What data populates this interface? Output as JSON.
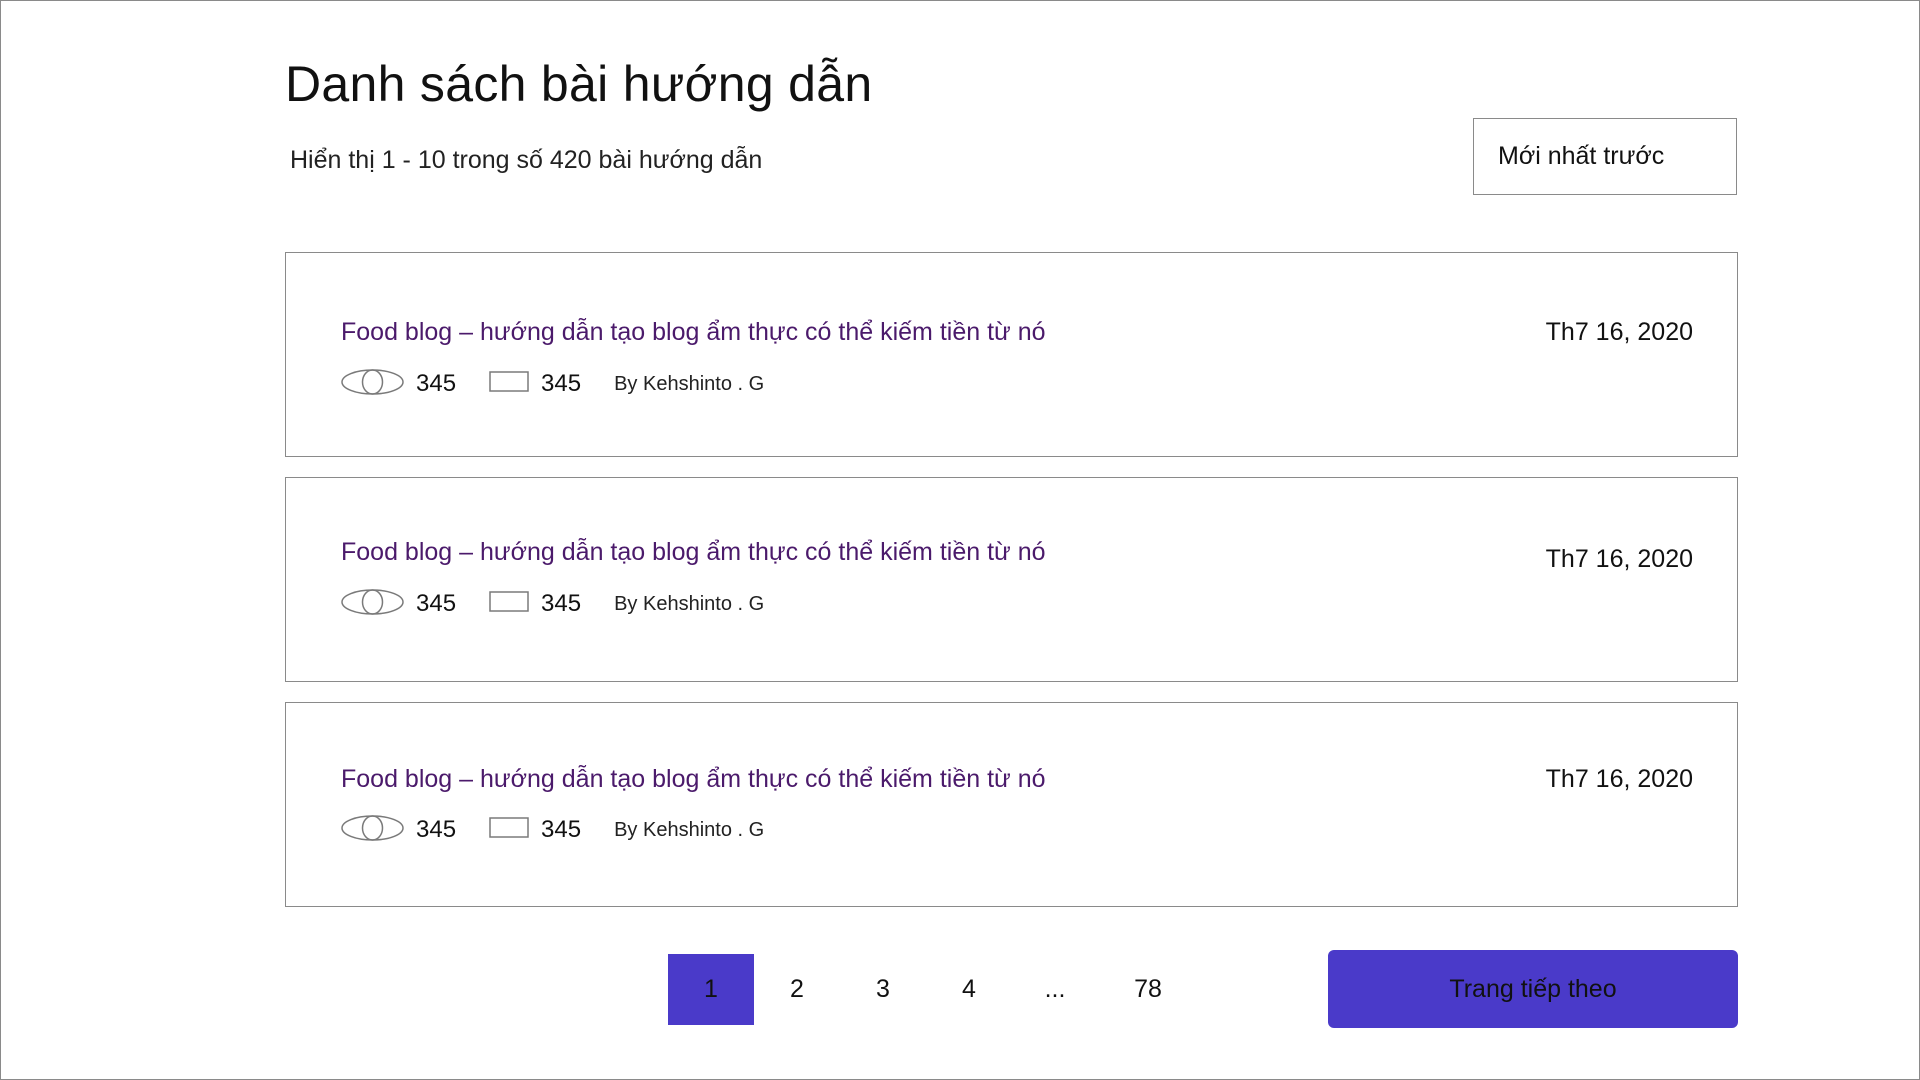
{
  "header": {
    "title": "Danh sách bài hướng dẫn",
    "result_summary": "Hiển thị 1 - 10 trong số 420 bài hướng dẫn",
    "sort_selected": "Mới nhất trước"
  },
  "posts": [
    {
      "title": "Food blog – hướng dẫn tạo blog ẩm thực có thể kiếm tiền từ nó",
      "date": "Th7 16, 2020",
      "views": "345",
      "comments": "345",
      "author": "By Kehshinto . G"
    },
    {
      "title": "Food blog – hướng dẫn tạo blog ẩm thực có thể kiếm tiền từ nó",
      "date": "Th7 16, 2020",
      "views": "345",
      "comments": "345",
      "author": "By Kehshinto . G"
    },
    {
      "title": "Food blog – hướng dẫn tạo blog ẩm thực có thể kiếm tiền từ nó",
      "date": "Th7 16, 2020",
      "views": "345",
      "comments": "345",
      "author": "By Kehshinto . G"
    }
  ],
  "icons": {
    "views": "eye-icon",
    "comments": "comment-icon"
  },
  "pagination": {
    "pages": [
      "1",
      "2",
      "3",
      "4",
      "...",
      "78"
    ],
    "current": "1",
    "next_label": "Trang tiếp theo"
  },
  "colors": {
    "accent": "#4a3ac9",
    "post_title": "#4b1a6b",
    "border": "#8a8a8a"
  }
}
